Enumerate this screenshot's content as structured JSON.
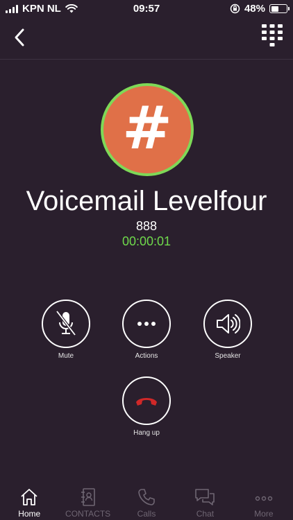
{
  "status": {
    "carrier": "KPN NL",
    "time": "09:57",
    "battery": "48%",
    "battery_level": 0.48
  },
  "call": {
    "avatar_glyph": "#",
    "name": "Voicemail Levelfour",
    "number": "888",
    "timer": "00:00:01"
  },
  "controls": {
    "mute": "Mute",
    "actions": "Actions",
    "speaker": "Speaker",
    "hangup": "Hang up"
  },
  "tabs": [
    {
      "label": "Home",
      "icon": "home-icon",
      "active": true
    },
    {
      "label": "CONTACTS",
      "icon": "contacts-book-icon",
      "active": false
    },
    {
      "label": "Calls",
      "icon": "phone-icon",
      "active": false
    },
    {
      "label": "Chat",
      "icon": "chat-bubbles-icon",
      "active": false
    },
    {
      "label": "More",
      "icon": "more-dots-icon",
      "active": false
    }
  ],
  "colors": {
    "background": "#2a1f2d",
    "avatar": "#e07048",
    "avatar_ring": "#7ed957",
    "timer": "#6fd94b",
    "hangup": "#d02828"
  }
}
